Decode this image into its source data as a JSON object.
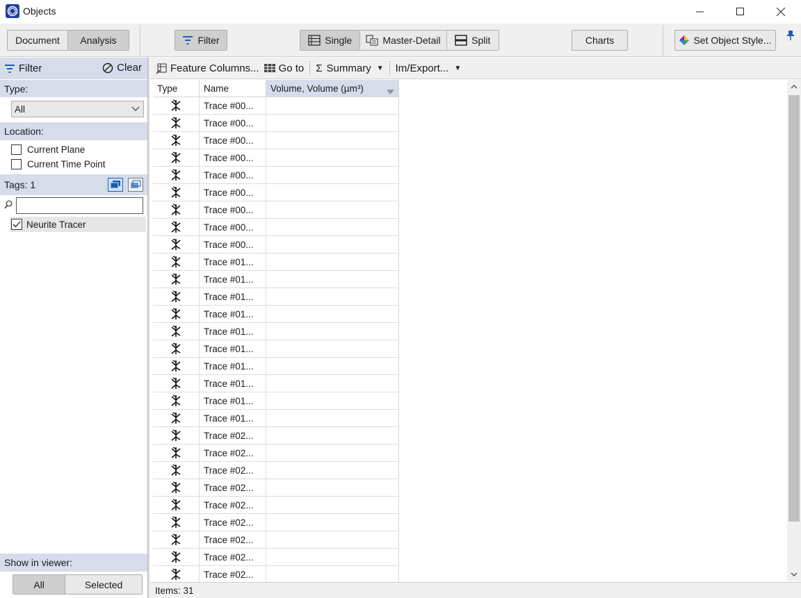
{
  "window": {
    "title": "Objects",
    "minimize_icon": "minimize-icon",
    "maximize_icon": "maximize-icon",
    "close_icon": "close-icon"
  },
  "toolbar": {
    "document_label": "Document",
    "analysis_label": "Analysis",
    "filter_label": "Filter",
    "single_label": "Single",
    "master_detail_label": "Master-Detail",
    "split_label": "Split",
    "charts_label": "Charts",
    "set_style_label": "Set Object Style...",
    "active_mode": "Analysis",
    "active_view": "Single"
  },
  "filter_panel": {
    "header": "Filter",
    "clear_label": "Clear",
    "type_label": "Type:",
    "type_value": "All",
    "location_label": "Location:",
    "location_options": [
      "Current Plane",
      "Current Time Point"
    ],
    "tags_label": "Tags: 1",
    "tags": [
      {
        "label": "Neurite Tracer",
        "checked": true
      }
    ],
    "show_in_viewer_label": "Show in viewer:",
    "show_all_label": "All",
    "show_selected_label": "Selected"
  },
  "actions": {
    "feature_columns": "Feature Columns...",
    "goto": "Go to",
    "summary": "Summary",
    "imexport": "Im/Export..."
  },
  "table": {
    "columns": [
      "Type",
      "Name",
      "Volume, Volume (µm³)"
    ],
    "rows": [
      "Trace #00...",
      "Trace #00...",
      "Trace #00...",
      "Trace #00...",
      "Trace #00...",
      "Trace #00...",
      "Trace #00...",
      "Trace #00...",
      "Trace #00...",
      "Trace #01...",
      "Trace #01...",
      "Trace #01...",
      "Trace #01...",
      "Trace #01...",
      "Trace #01...",
      "Trace #01...",
      "Trace #01...",
      "Trace #01...",
      "Trace #01...",
      "Trace #02...",
      "Trace #02...",
      "Trace #02...",
      "Trace #02...",
      "Trace #02...",
      "Trace #02...",
      "Trace #02...",
      "Trace #02...",
      "Trace #02..."
    ],
    "row_icon": "neurite-trace-icon"
  },
  "status": {
    "items_label": "Items: 31"
  },
  "colors": {
    "section_header": "#d6dcea",
    "toolbar_bg": "#f0f0f0",
    "accent_blue": "#1a5fb4"
  }
}
